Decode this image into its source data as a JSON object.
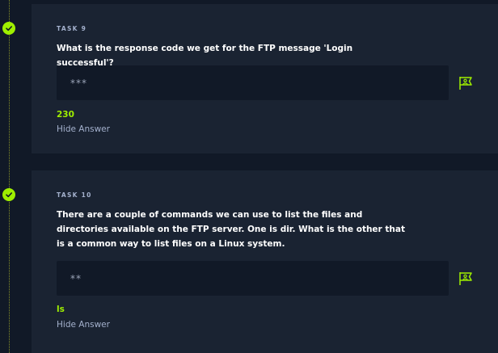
{
  "tasks": [
    {
      "label": "TASK 9",
      "question": "What is the response code we get for the FTP message 'Login successful'?",
      "answer_mask": "***",
      "answer": "230",
      "hide_answer_label": "Hide Answer",
      "completed": true
    },
    {
      "label": "TASK 10",
      "question": "There are a couple of commands we can use to list the files and directories available on the FTP server. One is dir. What is the other that is a common way to list files on a Linux system.",
      "answer_mask": "**",
      "answer": "ls",
      "hide_answer_label": "Hide Answer",
      "completed": true
    }
  ],
  "colors": {
    "accent": "#9fef00",
    "card_bg": "#1a2332",
    "page_bg": "#111927",
    "muted_text": "#a4b1cd"
  },
  "icons": {
    "completed": "check-icon",
    "submit": "flag-icon"
  }
}
